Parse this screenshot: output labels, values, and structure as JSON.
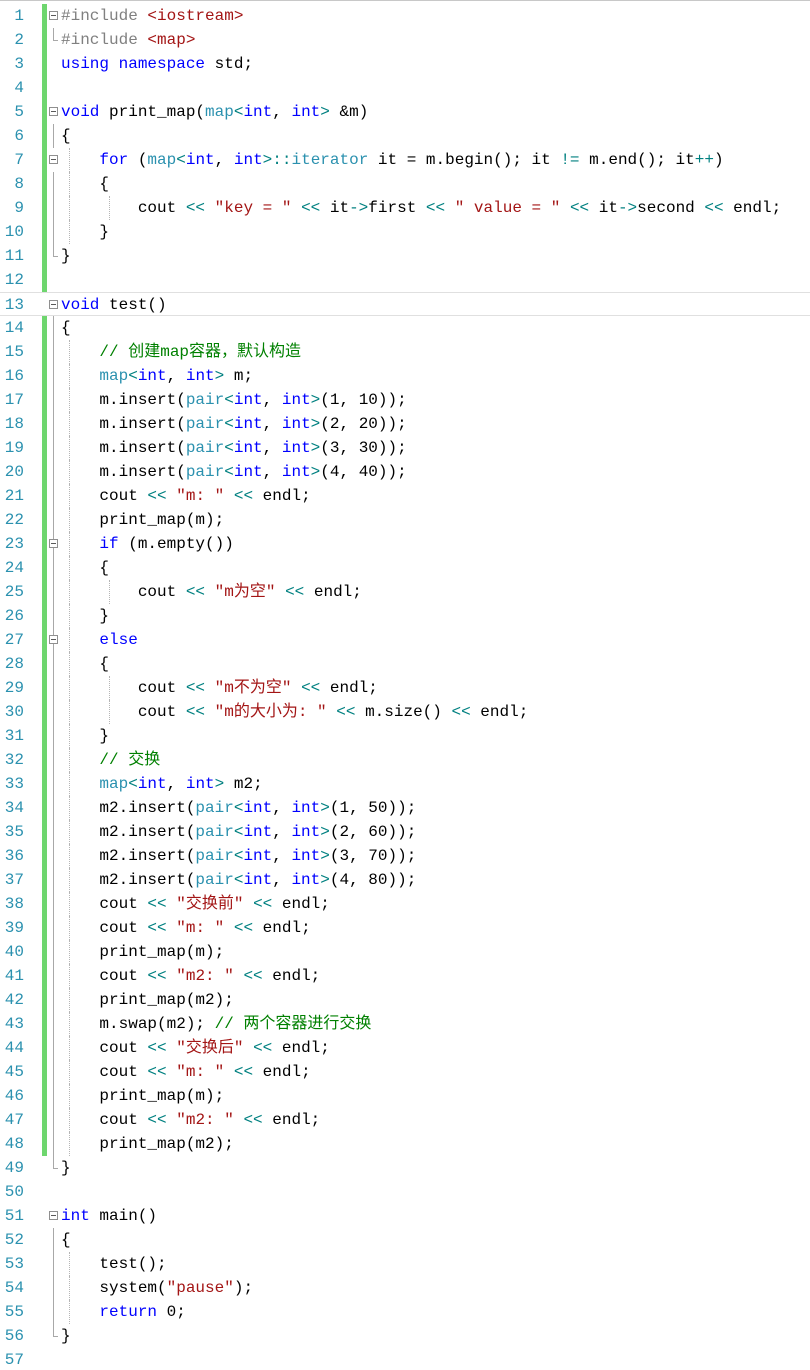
{
  "editor": {
    "language": "C++",
    "colors": {
      "line_number": "#2b91af",
      "keyword": "#0000ff",
      "type": "#2b91af",
      "string": "#a31515",
      "comment": "#008000",
      "operator": "#008080",
      "preprocessor": "#808080",
      "change_bar": "#6ed66e"
    },
    "lines": [
      {
        "n": "1",
        "tokens": [
          [
            "pp",
            "#include "
          ],
          [
            "str",
            "<iostream>"
          ]
        ]
      },
      {
        "n": "2",
        "tokens": [
          [
            "pp",
            "#include "
          ],
          [
            "str",
            "<map>"
          ]
        ]
      },
      {
        "n": "3",
        "tokens": [
          [
            "kw",
            "using namespace"
          ],
          [
            "pl",
            " std;"
          ]
        ]
      },
      {
        "n": "4",
        "tokens": []
      },
      {
        "n": "5",
        "tokens": [
          [
            "kw",
            "void"
          ],
          [
            "pl",
            " print_map("
          ],
          [
            "ty",
            "map"
          ],
          [
            "op",
            "<"
          ],
          [
            "kw",
            "int"
          ],
          [
            "pl",
            ", "
          ],
          [
            "kw",
            "int"
          ],
          [
            "op",
            ">"
          ],
          [
            "pl",
            " &m)"
          ]
        ]
      },
      {
        "n": "6",
        "tokens": [
          [
            "pl",
            "{"
          ]
        ]
      },
      {
        "n": "7",
        "tokens": [
          [
            "pl",
            "    "
          ],
          [
            "kw",
            "for"
          ],
          [
            "pl",
            " ("
          ],
          [
            "ty",
            "map"
          ],
          [
            "op",
            "<"
          ],
          [
            "kw",
            "int"
          ],
          [
            "pl",
            ", "
          ],
          [
            "kw",
            "int"
          ],
          [
            "op",
            ">::"
          ],
          [
            "ty",
            "iterator"
          ],
          [
            "pl",
            " it = m.begin(); it "
          ],
          [
            "op",
            "!="
          ],
          [
            "pl",
            " m.end(); it"
          ],
          [
            "op",
            "++"
          ],
          [
            "pl",
            ")"
          ]
        ]
      },
      {
        "n": "8",
        "tokens": [
          [
            "pl",
            "    {"
          ]
        ]
      },
      {
        "n": "9",
        "tokens": [
          [
            "pl",
            "        cout "
          ],
          [
            "op",
            "<<"
          ],
          [
            "pl",
            " "
          ],
          [
            "str",
            "\"key = \""
          ],
          [
            "pl",
            " "
          ],
          [
            "op",
            "<<"
          ],
          [
            "pl",
            " it"
          ],
          [
            "op",
            "->"
          ],
          [
            "pl",
            "first "
          ],
          [
            "op",
            "<<"
          ],
          [
            "pl",
            " "
          ],
          [
            "str",
            "\" value = \""
          ],
          [
            "pl",
            " "
          ],
          [
            "op",
            "<<"
          ],
          [
            "pl",
            " it"
          ],
          [
            "op",
            "->"
          ],
          [
            "pl",
            "second "
          ],
          [
            "op",
            "<<"
          ],
          [
            "pl",
            " endl;"
          ]
        ]
      },
      {
        "n": "10",
        "tokens": [
          [
            "pl",
            "    }"
          ]
        ]
      },
      {
        "n": "11",
        "tokens": [
          [
            "pl",
            "}"
          ]
        ]
      },
      {
        "n": "12",
        "tokens": []
      },
      {
        "n": "13",
        "tokens": [
          [
            "kw",
            "void"
          ],
          [
            "pl",
            " test()"
          ]
        ]
      },
      {
        "n": "14",
        "tokens": [
          [
            "pl",
            "{"
          ]
        ]
      },
      {
        "n": "15",
        "tokens": [
          [
            "pl",
            "    "
          ],
          [
            "cm",
            "// 创建map容器，默认构造"
          ]
        ]
      },
      {
        "n": "16",
        "tokens": [
          [
            "pl",
            "    "
          ],
          [
            "ty",
            "map"
          ],
          [
            "op",
            "<"
          ],
          [
            "kw",
            "int"
          ],
          [
            "pl",
            ", "
          ],
          [
            "kw",
            "int"
          ],
          [
            "op",
            ">"
          ],
          [
            "pl",
            " m;"
          ]
        ]
      },
      {
        "n": "17",
        "tokens": [
          [
            "pl",
            "    m.insert("
          ],
          [
            "ty",
            "pair"
          ],
          [
            "op",
            "<"
          ],
          [
            "kw",
            "int"
          ],
          [
            "pl",
            ", "
          ],
          [
            "kw",
            "int"
          ],
          [
            "op",
            ">"
          ],
          [
            "pl",
            "(1, 10));"
          ]
        ]
      },
      {
        "n": "18",
        "tokens": [
          [
            "pl",
            "    m.insert("
          ],
          [
            "ty",
            "pair"
          ],
          [
            "op",
            "<"
          ],
          [
            "kw",
            "int"
          ],
          [
            "pl",
            ", "
          ],
          [
            "kw",
            "int"
          ],
          [
            "op",
            ">"
          ],
          [
            "pl",
            "(2, 20));"
          ]
        ]
      },
      {
        "n": "19",
        "tokens": [
          [
            "pl",
            "    m.insert("
          ],
          [
            "ty",
            "pair"
          ],
          [
            "op",
            "<"
          ],
          [
            "kw",
            "int"
          ],
          [
            "pl",
            ", "
          ],
          [
            "kw",
            "int"
          ],
          [
            "op",
            ">"
          ],
          [
            "pl",
            "(3, 30));"
          ]
        ]
      },
      {
        "n": "20",
        "tokens": [
          [
            "pl",
            "    m.insert("
          ],
          [
            "ty",
            "pair"
          ],
          [
            "op",
            "<"
          ],
          [
            "kw",
            "int"
          ],
          [
            "pl",
            ", "
          ],
          [
            "kw",
            "int"
          ],
          [
            "op",
            ">"
          ],
          [
            "pl",
            "(4, 40));"
          ]
        ]
      },
      {
        "n": "21",
        "tokens": [
          [
            "pl",
            "    cout "
          ],
          [
            "op",
            "<<"
          ],
          [
            "pl",
            " "
          ],
          [
            "str",
            "\"m: \""
          ],
          [
            "pl",
            " "
          ],
          [
            "op",
            "<<"
          ],
          [
            "pl",
            " endl;"
          ]
        ]
      },
      {
        "n": "22",
        "tokens": [
          [
            "pl",
            "    print_map(m);"
          ]
        ]
      },
      {
        "n": "23",
        "tokens": [
          [
            "pl",
            "    "
          ],
          [
            "kw",
            "if"
          ],
          [
            "pl",
            " (m.empty())"
          ]
        ]
      },
      {
        "n": "24",
        "tokens": [
          [
            "pl",
            "    {"
          ]
        ]
      },
      {
        "n": "25",
        "tokens": [
          [
            "pl",
            "        cout "
          ],
          [
            "op",
            "<<"
          ],
          [
            "pl",
            " "
          ],
          [
            "str",
            "\"m为空\""
          ],
          [
            "pl",
            " "
          ],
          [
            "op",
            "<<"
          ],
          [
            "pl",
            " endl;"
          ]
        ]
      },
      {
        "n": "26",
        "tokens": [
          [
            "pl",
            "    }"
          ]
        ]
      },
      {
        "n": "27",
        "tokens": [
          [
            "pl",
            "    "
          ],
          [
            "kw",
            "else"
          ]
        ]
      },
      {
        "n": "28",
        "tokens": [
          [
            "pl",
            "    {"
          ]
        ]
      },
      {
        "n": "29",
        "tokens": [
          [
            "pl",
            "        cout "
          ],
          [
            "op",
            "<<"
          ],
          [
            "pl",
            " "
          ],
          [
            "str",
            "\"m不为空\""
          ],
          [
            "pl",
            " "
          ],
          [
            "op",
            "<<"
          ],
          [
            "pl",
            " endl;"
          ]
        ]
      },
      {
        "n": "30",
        "tokens": [
          [
            "pl",
            "        cout "
          ],
          [
            "op",
            "<<"
          ],
          [
            "pl",
            " "
          ],
          [
            "str",
            "\"m的大小为: \""
          ],
          [
            "pl",
            " "
          ],
          [
            "op",
            "<<"
          ],
          [
            "pl",
            " m.size() "
          ],
          [
            "op",
            "<<"
          ],
          [
            "pl",
            " endl;"
          ]
        ]
      },
      {
        "n": "31",
        "tokens": [
          [
            "pl",
            "    }"
          ]
        ]
      },
      {
        "n": "32",
        "tokens": [
          [
            "pl",
            "    "
          ],
          [
            "cm",
            "// 交换"
          ]
        ]
      },
      {
        "n": "33",
        "tokens": [
          [
            "pl",
            "    "
          ],
          [
            "ty",
            "map"
          ],
          [
            "op",
            "<"
          ],
          [
            "kw",
            "int"
          ],
          [
            "pl",
            ", "
          ],
          [
            "kw",
            "int"
          ],
          [
            "op",
            ">"
          ],
          [
            "pl",
            " m2;"
          ]
        ]
      },
      {
        "n": "34",
        "tokens": [
          [
            "pl",
            "    m2.insert("
          ],
          [
            "ty",
            "pair"
          ],
          [
            "op",
            "<"
          ],
          [
            "kw",
            "int"
          ],
          [
            "pl",
            ", "
          ],
          [
            "kw",
            "int"
          ],
          [
            "op",
            ">"
          ],
          [
            "pl",
            "(1, 50));"
          ]
        ]
      },
      {
        "n": "35",
        "tokens": [
          [
            "pl",
            "    m2.insert("
          ],
          [
            "ty",
            "pair"
          ],
          [
            "op",
            "<"
          ],
          [
            "kw",
            "int"
          ],
          [
            "pl",
            ", "
          ],
          [
            "kw",
            "int"
          ],
          [
            "op",
            ">"
          ],
          [
            "pl",
            "(2, 60));"
          ]
        ]
      },
      {
        "n": "36",
        "tokens": [
          [
            "pl",
            "    m2.insert("
          ],
          [
            "ty",
            "pair"
          ],
          [
            "op",
            "<"
          ],
          [
            "kw",
            "int"
          ],
          [
            "pl",
            ", "
          ],
          [
            "kw",
            "int"
          ],
          [
            "op",
            ">"
          ],
          [
            "pl",
            "(3, 70));"
          ]
        ]
      },
      {
        "n": "37",
        "tokens": [
          [
            "pl",
            "    m2.insert("
          ],
          [
            "ty",
            "pair"
          ],
          [
            "op",
            "<"
          ],
          [
            "kw",
            "int"
          ],
          [
            "pl",
            ", "
          ],
          [
            "kw",
            "int"
          ],
          [
            "op",
            ">"
          ],
          [
            "pl",
            "(4, 80));"
          ]
        ]
      },
      {
        "n": "38",
        "tokens": [
          [
            "pl",
            "    cout "
          ],
          [
            "op",
            "<<"
          ],
          [
            "pl",
            " "
          ],
          [
            "str",
            "\"交换前\""
          ],
          [
            "pl",
            " "
          ],
          [
            "op",
            "<<"
          ],
          [
            "pl",
            " endl;"
          ]
        ]
      },
      {
        "n": "39",
        "tokens": [
          [
            "pl",
            "    cout "
          ],
          [
            "op",
            "<<"
          ],
          [
            "pl",
            " "
          ],
          [
            "str",
            "\"m: \""
          ],
          [
            "pl",
            " "
          ],
          [
            "op",
            "<<"
          ],
          [
            "pl",
            " endl;"
          ]
        ]
      },
      {
        "n": "40",
        "tokens": [
          [
            "pl",
            "    print_map(m);"
          ]
        ]
      },
      {
        "n": "41",
        "tokens": [
          [
            "pl",
            "    cout "
          ],
          [
            "op",
            "<<"
          ],
          [
            "pl",
            " "
          ],
          [
            "str",
            "\"m2: \""
          ],
          [
            "pl",
            " "
          ],
          [
            "op",
            "<<"
          ],
          [
            "pl",
            " endl;"
          ]
        ]
      },
      {
        "n": "42",
        "tokens": [
          [
            "pl",
            "    print_map(m2);"
          ]
        ]
      },
      {
        "n": "43",
        "tokens": [
          [
            "pl",
            "    m.swap(m2); "
          ],
          [
            "cm",
            "// 两个容器进行交换"
          ]
        ]
      },
      {
        "n": "44",
        "tokens": [
          [
            "pl",
            "    cout "
          ],
          [
            "op",
            "<<"
          ],
          [
            "pl",
            " "
          ],
          [
            "str",
            "\"交换后\""
          ],
          [
            "pl",
            " "
          ],
          [
            "op",
            "<<"
          ],
          [
            "pl",
            " endl;"
          ]
        ]
      },
      {
        "n": "45",
        "tokens": [
          [
            "pl",
            "    cout "
          ],
          [
            "op",
            "<<"
          ],
          [
            "pl",
            " "
          ],
          [
            "str",
            "\"m: \""
          ],
          [
            "pl",
            " "
          ],
          [
            "op",
            "<<"
          ],
          [
            "pl",
            " endl;"
          ]
        ]
      },
      {
        "n": "46",
        "tokens": [
          [
            "pl",
            "    print_map(m);"
          ]
        ]
      },
      {
        "n": "47",
        "tokens": [
          [
            "pl",
            "    cout "
          ],
          [
            "op",
            "<<"
          ],
          [
            "pl",
            " "
          ],
          [
            "str",
            "\"m2: \""
          ],
          [
            "pl",
            " "
          ],
          [
            "op",
            "<<"
          ],
          [
            "pl",
            " endl;"
          ]
        ]
      },
      {
        "n": "48",
        "tokens": [
          [
            "pl",
            "    print_map(m2);"
          ]
        ]
      },
      {
        "n": "49",
        "tokens": [
          [
            "pl",
            "}"
          ]
        ]
      },
      {
        "n": "50",
        "tokens": []
      },
      {
        "n": "51",
        "tokens": [
          [
            "kw",
            "int"
          ],
          [
            "pl",
            " main()"
          ]
        ]
      },
      {
        "n": "52",
        "tokens": [
          [
            "pl",
            "{"
          ]
        ]
      },
      {
        "n": "53",
        "tokens": [
          [
            "pl",
            "    test();"
          ]
        ]
      },
      {
        "n": "54",
        "tokens": [
          [
            "pl",
            "    system("
          ],
          [
            "str",
            "\"pause\""
          ],
          [
            "pl",
            ");"
          ]
        ]
      },
      {
        "n": "55",
        "tokens": [
          [
            "pl",
            "    "
          ],
          [
            "kw",
            "return"
          ],
          [
            "pl",
            " 0;"
          ]
        ]
      },
      {
        "n": "56",
        "tokens": [
          [
            "pl",
            "}"
          ]
        ]
      },
      {
        "n": "57",
        "tokens": []
      }
    ]
  }
}
